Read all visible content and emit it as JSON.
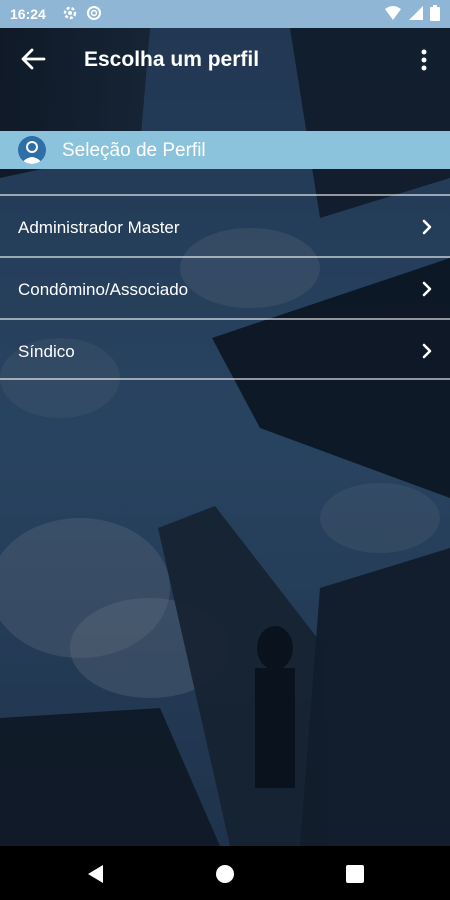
{
  "statusbar": {
    "time": "16:24",
    "left_icons": [
      "gear-icon",
      "sync-icon"
    ],
    "right_icons": [
      "wifi-icon",
      "signal-icon",
      "battery-icon"
    ]
  },
  "appbar": {
    "title": "Escolha um perfil",
    "back_icon": "arrow-left-icon",
    "menu_icon": "more-vertical-icon"
  },
  "section": {
    "label": "Seleção de Perfil",
    "icon": "user-avatar-icon"
  },
  "menu": {
    "items": [
      {
        "label": "Administrador Master"
      },
      {
        "label": "Condômino/Associado"
      },
      {
        "label": "Síndico"
      }
    ]
  },
  "navbar": {
    "buttons": [
      "back-triangle-icon",
      "home-circle-icon",
      "recents-square-icon"
    ]
  },
  "colors": {
    "statusbar": "#8fb6d4",
    "section_header": "#8cc3dc",
    "avatar": "#2d6fa6"
  }
}
